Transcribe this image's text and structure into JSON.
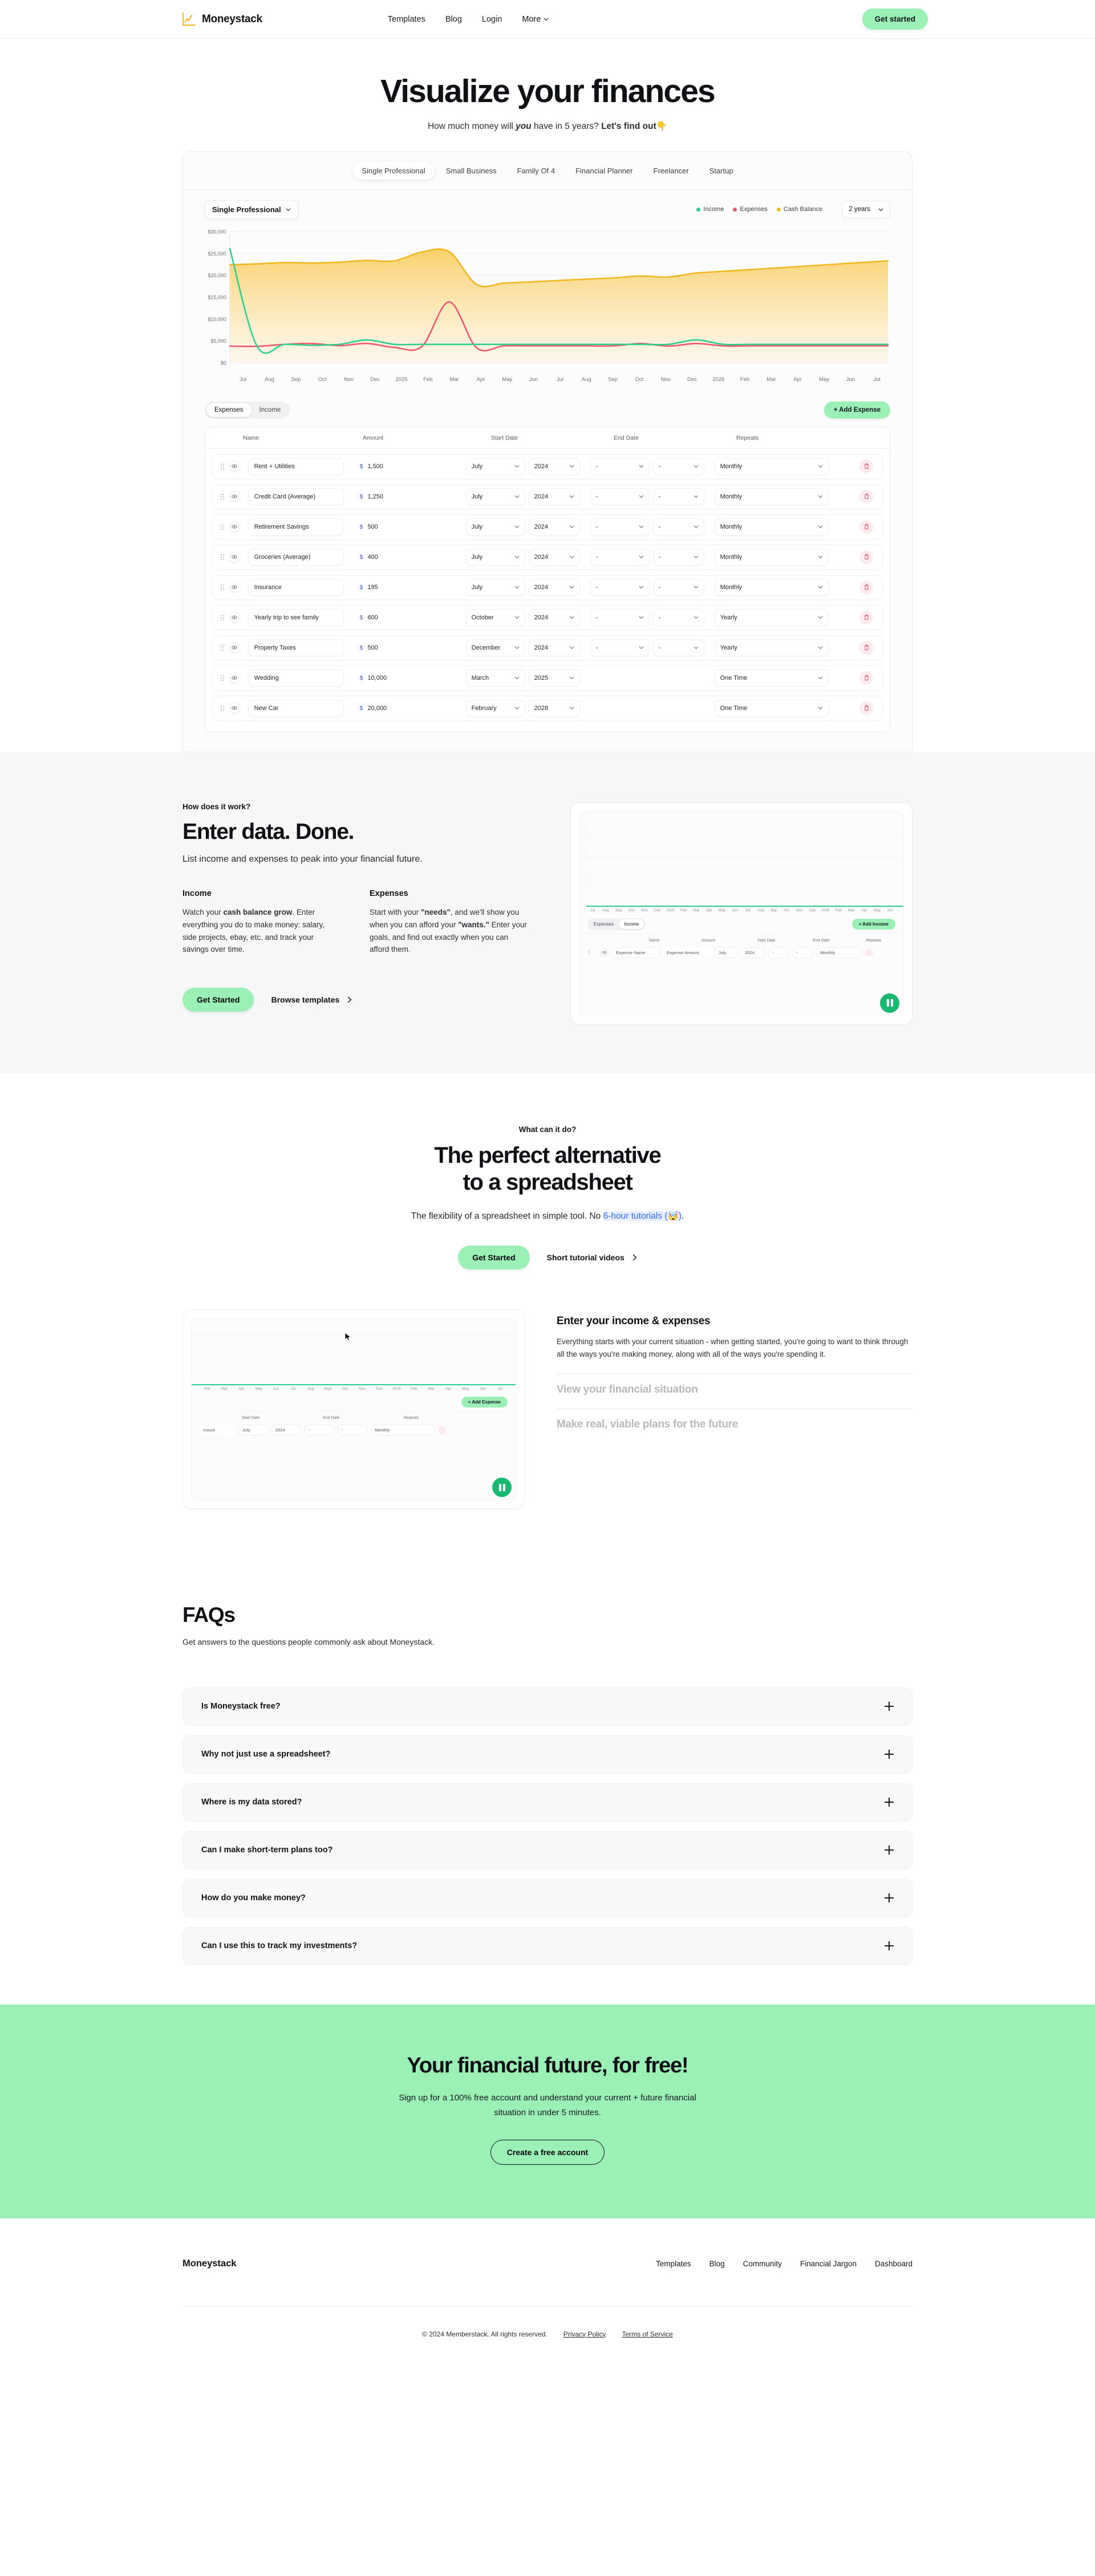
{
  "nav": {
    "brand": "Moneystack",
    "logo_icon": "line-chart-icon",
    "links": [
      {
        "label": "Templates"
      },
      {
        "label": "Blog"
      },
      {
        "label": "Login"
      }
    ],
    "more_label": "More",
    "cta_label": "Get started",
    "accent_green": "#9bf0b6",
    "accent_yellow": "#f2b71e"
  },
  "hero": {
    "title": "Visualize your finances",
    "sub_prefix": "How much money will ",
    "sub_em": "you",
    "sub_mid": " have in 5 years? ",
    "sub_strong": "Let's find out",
    "sub_emoji": "👇"
  },
  "app": {
    "persona_tabs": [
      {
        "label": "Single Professional",
        "active": true
      },
      {
        "label": "Small Business",
        "active": false
      },
      {
        "label": "Family Of 4",
        "active": false
      },
      {
        "label": "Financial Planner",
        "active": false
      },
      {
        "label": "Freelancer",
        "active": false
      },
      {
        "label": "Startup",
        "active": false
      }
    ],
    "selected_template": "Single Professional",
    "range_label": "2 years",
    "legend": [
      {
        "label": "Income",
        "color": "#2ecc8f"
      },
      {
        "label": "Expenses",
        "color": "#ef5a72"
      },
      {
        "label": "Cash Balance",
        "color": "#f2b71e"
      }
    ],
    "table_tabs": [
      {
        "label": "Expenses",
        "active": true
      },
      {
        "label": "Income",
        "active": false
      }
    ],
    "add_button": "+  Add Expense",
    "columns": [
      "Name",
      "Amount",
      "Start Date",
      "End Date",
      "Repeats"
    ],
    "empty_value": "-",
    "currency_symbol": "$",
    "rows": [
      {
        "name": "Rent + Utilities",
        "amount": "1,500",
        "start_month": "July",
        "start_year": "2024",
        "end_month": "-",
        "end_year": "-",
        "repeats": "Monthly",
        "one_time": false
      },
      {
        "name": "Credit Card (Average)",
        "amount": "1,250",
        "start_month": "July",
        "start_year": "2024",
        "end_month": "-",
        "end_year": "-",
        "repeats": "Monthly",
        "one_time": false
      },
      {
        "name": "Retirement Savings",
        "amount": "500",
        "start_month": "July",
        "start_year": "2024",
        "end_month": "-",
        "end_year": "-",
        "repeats": "Monthly",
        "one_time": false
      },
      {
        "name": "Groceries (Average)",
        "amount": "400",
        "start_month": "July",
        "start_year": "2024",
        "end_month": "-",
        "end_year": "-",
        "repeats": "Monthly",
        "one_time": false
      },
      {
        "name": "Insurance",
        "amount": "195",
        "start_month": "July",
        "start_year": "2024",
        "end_month": "-",
        "end_year": "-",
        "repeats": "Monthly",
        "one_time": false
      },
      {
        "name": "Yearly trip to see family",
        "amount": "600",
        "start_month": "October",
        "start_year": "2024",
        "end_month": "-",
        "end_year": "-",
        "repeats": "Yearly",
        "one_time": false
      },
      {
        "name": "Property Taxes",
        "amount": "500",
        "start_month": "December",
        "start_year": "2024",
        "end_month": "-",
        "end_year": "-",
        "repeats": "Yearly",
        "one_time": false
      },
      {
        "name": "Wedding",
        "amount": "10,000",
        "start_month": "March",
        "start_year": "2025",
        "end_month": "",
        "end_year": "",
        "repeats": "One Time",
        "one_time": true
      },
      {
        "name": "New Car",
        "amount": "20,000",
        "start_month": "February",
        "start_year": "2028",
        "end_month": "",
        "end_year": "",
        "repeats": "One Time",
        "one_time": true
      }
    ]
  },
  "chart_data": {
    "type": "area",
    "title": "",
    "xlabel": "",
    "ylabel": "",
    "ylim": [
      0,
      30000
    ],
    "ytick_labels": [
      "$30,000",
      "$25,000",
      "$20,000",
      "$15,000",
      "$10,000",
      "$5,000",
      "$0"
    ],
    "yticks": [
      30000,
      25000,
      20000,
      15000,
      10000,
      5000,
      0
    ],
    "grid": true,
    "legend_position": "top-right",
    "x": [
      "Jul",
      "Aug",
      "Sep",
      "Oct",
      "Nov",
      "Dec",
      "2025",
      "Feb",
      "Mar",
      "Apr",
      "May",
      "Jun",
      "Jul",
      "Aug",
      "Sep",
      "Oct",
      "Nov",
      "Dec",
      "2026",
      "Feb",
      "Mar",
      "Apr",
      "May",
      "Jun",
      "Jul"
    ],
    "series": [
      {
        "name": "Cash Balance",
        "color": "#f2b71e",
        "fill": true,
        "values": [
          22400,
          22600,
          22900,
          22800,
          23000,
          23400,
          23300,
          25300,
          25400,
          17900,
          18200,
          18500,
          18800,
          19100,
          19400,
          19800,
          19600,
          20500,
          20900,
          21300,
          21700,
          22100,
          22500,
          22900,
          23300
        ]
      },
      {
        "name": "Income",
        "color": "#2ecc8f",
        "fill": false,
        "values": [
          26100,
          3700,
          4200,
          4000,
          4200,
          5200,
          4200,
          4200,
          4200,
          4200,
          4200,
          4200,
          4200,
          4200,
          4200,
          4200,
          4200,
          5200,
          4200,
          4200,
          4200,
          4200,
          4200,
          4200,
          4200
        ]
      },
      {
        "name": "Expenses",
        "color": "#ef5a72",
        "fill": false,
        "values": [
          3800,
          3750,
          4200,
          4400,
          3900,
          4400,
          3500,
          3700,
          13900,
          3400,
          3850,
          3850,
          3850,
          3850,
          3850,
          4400,
          3800,
          4400,
          3850,
          3850,
          3850,
          3850,
          3850,
          3850,
          3850
        ]
      }
    ]
  },
  "how": {
    "eyebrow": "How does it work?",
    "title": "Enter data. Done.",
    "lead": "List income and expenses to peak into your financial future.",
    "columns": [
      {
        "heading": "Income",
        "p1": "Watch your ",
        "p_bold": "cash balance grow",
        "p2": ". Enter everything you do to make money: salary, side projects, ebay, etc. and track your savings over time."
      },
      {
        "heading": "Expenses",
        "p1": "Start with your ",
        "p_bold": "\"needs\"",
        "p2": ", and we'll show you when you can afford your ",
        "p_bold2": "\"wants.\"",
        "p3": " Enter your goals, and find out exactly when you can afford them."
      }
    ],
    "primary_cta": "Get Started",
    "secondary_cta": "Browse templates"
  },
  "video_income": {
    "x_labels": [
      "Jul",
      "Aug",
      "Sep",
      "Oct",
      "Nov",
      "Dec",
      "2025",
      "Feb",
      "Mar",
      "Apr",
      "May",
      "Jun",
      "Jul",
      "Aug",
      "Sep",
      "Oct",
      "Nov",
      "Dec",
      "2026",
      "Feb",
      "Mar",
      "Apr",
      "May",
      "Jun"
    ],
    "tabs": [
      {
        "label": "Expenses",
        "active": false
      },
      {
        "label": "Income",
        "active": true
      }
    ],
    "add_label": "+  Add Income",
    "columns": [
      "Name",
      "Amount",
      "Start Date",
      "End Date",
      "Repeats"
    ],
    "row": {
      "name_placeholder": "Expense Name",
      "amount_placeholder": "Expense Amount",
      "start_month": "July",
      "start_year": "2024",
      "end_month": "-",
      "end_year": "-",
      "repeats": "Monthly"
    },
    "play_state": "pause"
  },
  "alt": {
    "eyebrow": "What can it do?",
    "title_line1": "The perfect alternative",
    "title_line2": "to a spreadsheet",
    "lead_prefix": "The flexibility of a spreadsheet in simple tool.  No ",
    "lead_link": "6-hour tutorials (🤯)",
    "lead_suffix": ".",
    "primary_cta": "Get Started",
    "secondary_cta": "Short tutorial videos"
  },
  "video_expense": {
    "x_labels": [
      "Feb",
      "Mar",
      "Apr",
      "May",
      "Jun",
      "Jul",
      "Aug",
      "Sept",
      "Oct",
      "Nov",
      "Dec",
      "2025",
      "Feb",
      "Mar",
      "Apr",
      "May",
      "Jun",
      "Jul"
    ],
    "add_label": "+  Add Expense",
    "columns": [
      "Start Date",
      "End Date",
      "Repeats"
    ],
    "row": {
      "amount_placeholder": "mount",
      "start_month": "July",
      "start_year": "2024",
      "end_month": "-",
      "end_year": "-",
      "repeats": "Monthly"
    },
    "play_state": "pause"
  },
  "accordion": [
    {
      "title": "Enter your income & expenses",
      "open": true,
      "body": "Everything starts with your current situation - when getting started, you're going to want to think through all the ways you're making money, along with all of the ways you're spending it."
    },
    {
      "title": "View your financial situation",
      "open": false,
      "body": ""
    },
    {
      "title": "Make real, viable plans for the future",
      "open": false,
      "body": ""
    }
  ],
  "faq": {
    "title": "FAQs",
    "sub": "Get answers to the questions people commonly ask about Moneystack.",
    "items": [
      {
        "q": "Is Moneystack free?"
      },
      {
        "q": "Why not just use a spreadsheet?"
      },
      {
        "q": "Where is my data stored?"
      },
      {
        "q": "Can I make short-term plans too?"
      },
      {
        "q": "How do you make money?"
      },
      {
        "q": "Can I use this to track my investments?"
      }
    ]
  },
  "cta": {
    "title": "Your financial future, for free!",
    "sub_line1": "Sign up for a 100% free account and understand your current + future financial",
    "sub_line2": "situation in under 5 minutes.",
    "button": "Create a free account",
    "bg": "#9bf0b6"
  },
  "footer": {
    "brand": "Moneystack",
    "links": [
      {
        "label": "Templates"
      },
      {
        "label": "Blog"
      },
      {
        "label": "Community"
      },
      {
        "label": "Financial Jargon"
      },
      {
        "label": "Dashboard"
      }
    ],
    "copyright": "© 2024 Memberstack. All rights reserved.",
    "legal": [
      {
        "label": "Privacy Policy"
      },
      {
        "label": "Terms of Service"
      }
    ]
  }
}
